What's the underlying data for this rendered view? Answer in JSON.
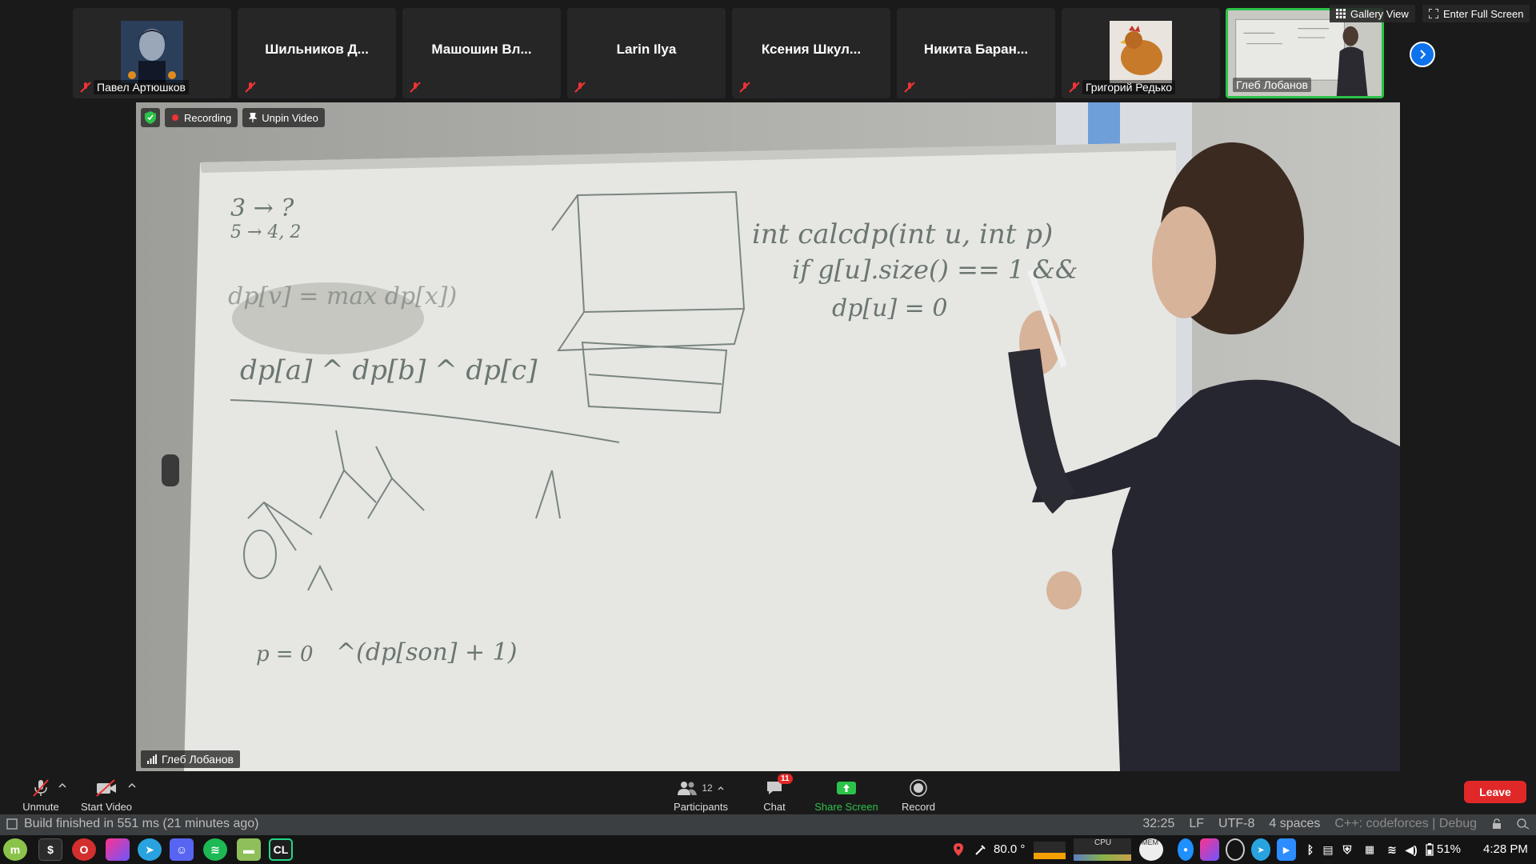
{
  "strip": {
    "participants": [
      {
        "name": "Павел Артюшков",
        "muted": true,
        "has_avatar": true,
        "avatar": "person-portrait"
      },
      {
        "name": "Шильников Д...",
        "muted": true
      },
      {
        "name": "Машошин Вл...",
        "muted": true
      },
      {
        "name": "Larin Ilya",
        "muted": true
      },
      {
        "name": "Ксения Шкул...",
        "muted": true
      },
      {
        "name": "Никита Баран...",
        "muted": true
      },
      {
        "name": "Григорий Редько",
        "muted": true,
        "has_avatar": true,
        "avatar": "chicken-photo"
      },
      {
        "name": "Глеб Лобанов",
        "active": true
      }
    ],
    "next_icon": "chevron-right-icon"
  },
  "view_controls": {
    "gallery_view": "Gallery View",
    "enter_full_screen": "Enter Full Screen"
  },
  "video": {
    "recording_label": "Recording",
    "unpin_label": "Unpin Video",
    "speaker_name": "Глеб Лобанов",
    "whiteboard_lines": [
      "3 → ?",
      "5 → 4, 2",
      "dp[v] = max dp[x])",
      "dp[a] ^ dp[b] ^ dp[c]",
      "int calcdp(int u, int p)",
      "if g[u].size() == 1 &&",
      "dp[u] = 0",
      "^(dp[son] + 1)",
      "p = 0"
    ]
  },
  "toolbar": {
    "unmute": "Unmute",
    "start_video": "Start Video",
    "participants": "Participants",
    "participants_count": "12",
    "chat": "Chat",
    "chat_badge": "11",
    "share_screen": "Share Screen",
    "record": "Record",
    "leave": "Leave",
    "colors": {
      "share": "#2dc24a",
      "leave": "#e02828"
    }
  },
  "ide_status": {
    "build_message": "Build finished in 551 ms (21 minutes ago)",
    "position": "32:25",
    "line_sep": "LF",
    "encoding": "UTF-8",
    "indent": "4 spaces",
    "context": "C++: codeforces | Debug"
  },
  "taskbar": {
    "apps": [
      "mint-menu-icon",
      "terminal-icon",
      "opera-icon",
      "jetbrains-toolbox-icon",
      "telegram-icon",
      "discord-icon",
      "spotify-icon",
      "files-icon",
      "clion-icon"
    ],
    "temperature": "80.0 °",
    "cpu_label": "CPU",
    "mem_label": "MEM",
    "battery": "51%",
    "clock": "4:28 PM"
  }
}
